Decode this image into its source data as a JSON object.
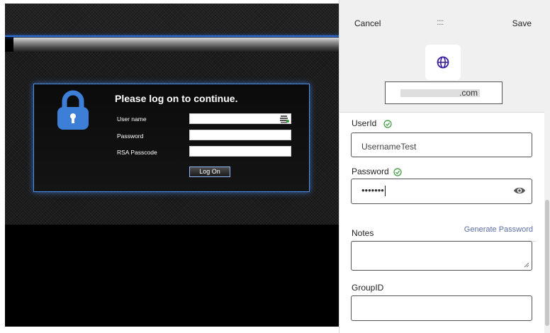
{
  "remote_page": {
    "title": "Please log on to continue.",
    "fields": [
      {
        "label": "User name"
      },
      {
        "label": "Password"
      },
      {
        "label": "RSA Passcode"
      }
    ],
    "logon_label": "Log On"
  },
  "panel": {
    "cancel_label": "Cancel",
    "save_label": "Save",
    "drag_handle": "::::",
    "site_icon": "globe-icon",
    "domain_suffix": ".com",
    "userid": {
      "label": "UserId",
      "value": "UsernameTest"
    },
    "password": {
      "label": "Password",
      "masked": "•••••••",
      "generate_label": "Generate Password"
    },
    "notes": {
      "label": "Notes",
      "value": ""
    },
    "groupid": {
      "label": "GroupID",
      "value": ""
    }
  },
  "colors": {
    "accent": "#3b1f9e",
    "check": "#3a9a3a",
    "link": "#5c6ea3",
    "remote_border": "#4a8cf0"
  }
}
